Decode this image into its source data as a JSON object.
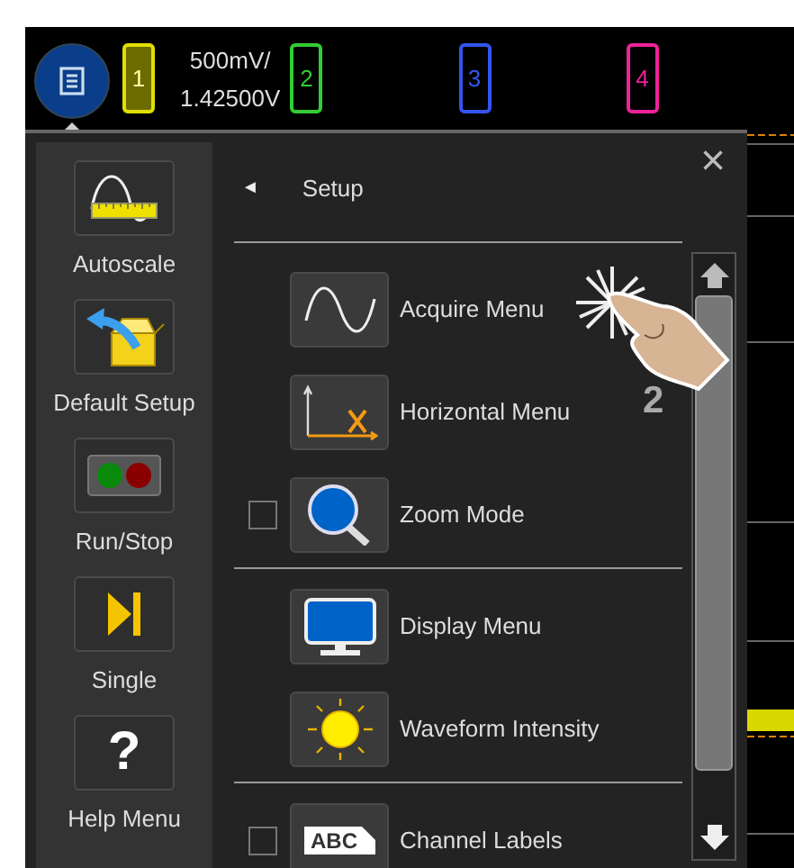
{
  "menu_button": {
    "expanded": true
  },
  "channels": [
    {
      "label": "1",
      "color": "#e0e000",
      "on": true,
      "scale": "500mV/",
      "offset": "1.42500V"
    },
    {
      "label": "2",
      "color": "#33cc33",
      "on": false
    },
    {
      "label": "3",
      "color": "#3355ee",
      "on": false
    },
    {
      "label": "4",
      "color": "#ee2299",
      "on": false
    }
  ],
  "sidebar": {
    "items": [
      {
        "label": "Autoscale"
      },
      {
        "label": "Default Setup"
      },
      {
        "label": "Run/Stop"
      },
      {
        "label": "Single"
      },
      {
        "label": "Help Menu",
        "glyph": "?"
      }
    ]
  },
  "menu": {
    "back": "◄",
    "title": "Setup",
    "close": "×",
    "sections": [
      {
        "items": [
          {
            "label": "Acquire Menu",
            "kind": "link"
          },
          {
            "label": "Horizontal Menu",
            "kind": "link"
          },
          {
            "label": "Zoom Mode",
            "kind": "toggle",
            "checked": false
          }
        ]
      },
      {
        "items": [
          {
            "label": "Display Menu",
            "kind": "link"
          },
          {
            "label": "Waveform Intensity",
            "kind": "link"
          }
        ]
      },
      {
        "items": [
          {
            "label": "Channel Labels",
            "kind": "toggle",
            "checked": false,
            "icon_text": "ABC"
          }
        ]
      }
    ]
  },
  "annotation": {
    "label": "2"
  }
}
